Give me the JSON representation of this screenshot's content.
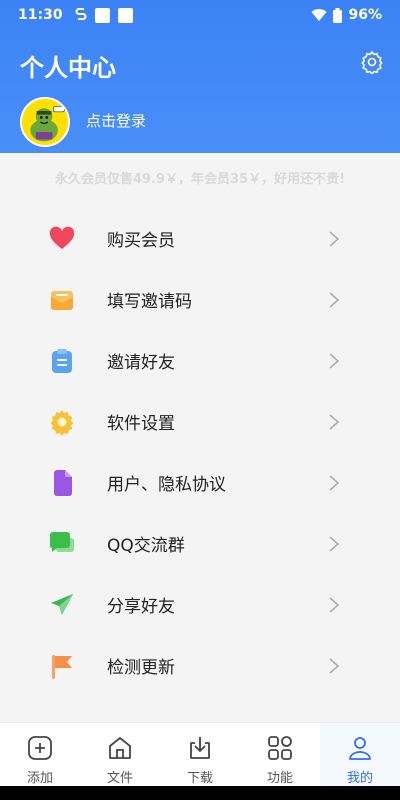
{
  "status_bar": {
    "time": "11:30",
    "battery": "96%"
  },
  "header": {
    "title": "个人中心",
    "login_text": "点击登录"
  },
  "promo_text": "永久会员仅售49.9￥，年会员35￥，好用还不贵!",
  "menu": [
    {
      "label": "购买会员",
      "icon": "heart-icon",
      "color": "#f0475c"
    },
    {
      "label": "填写邀请码",
      "icon": "envelope-icon",
      "color": "#f7a836"
    },
    {
      "label": "邀请好友",
      "icon": "clipboard-icon",
      "color": "#5aa2f4"
    },
    {
      "label": "软件设置",
      "icon": "settings-icon",
      "color": "#f7c234"
    },
    {
      "label": "用户、隐私协议",
      "icon": "document-icon",
      "color": "#9b57e3"
    },
    {
      "label": "QQ交流群",
      "icon": "chat-icon",
      "color": "#3cbf4a"
    },
    {
      "label": "分享好友",
      "icon": "send-icon",
      "color": "#38b855"
    },
    {
      "label": "检测更新",
      "icon": "flag-icon",
      "color": "#f78f4a"
    }
  ],
  "bottom_nav": [
    {
      "label": "添加",
      "icon": "add-icon"
    },
    {
      "label": "文件",
      "icon": "home-icon"
    },
    {
      "label": "下载",
      "icon": "download-icon"
    },
    {
      "label": "功能",
      "icon": "grid-icon"
    },
    {
      "label": "我的",
      "icon": "profile-icon",
      "active": true
    }
  ],
  "colors": {
    "header": "#3b82f6",
    "active_nav": "#2f6ff0"
  }
}
